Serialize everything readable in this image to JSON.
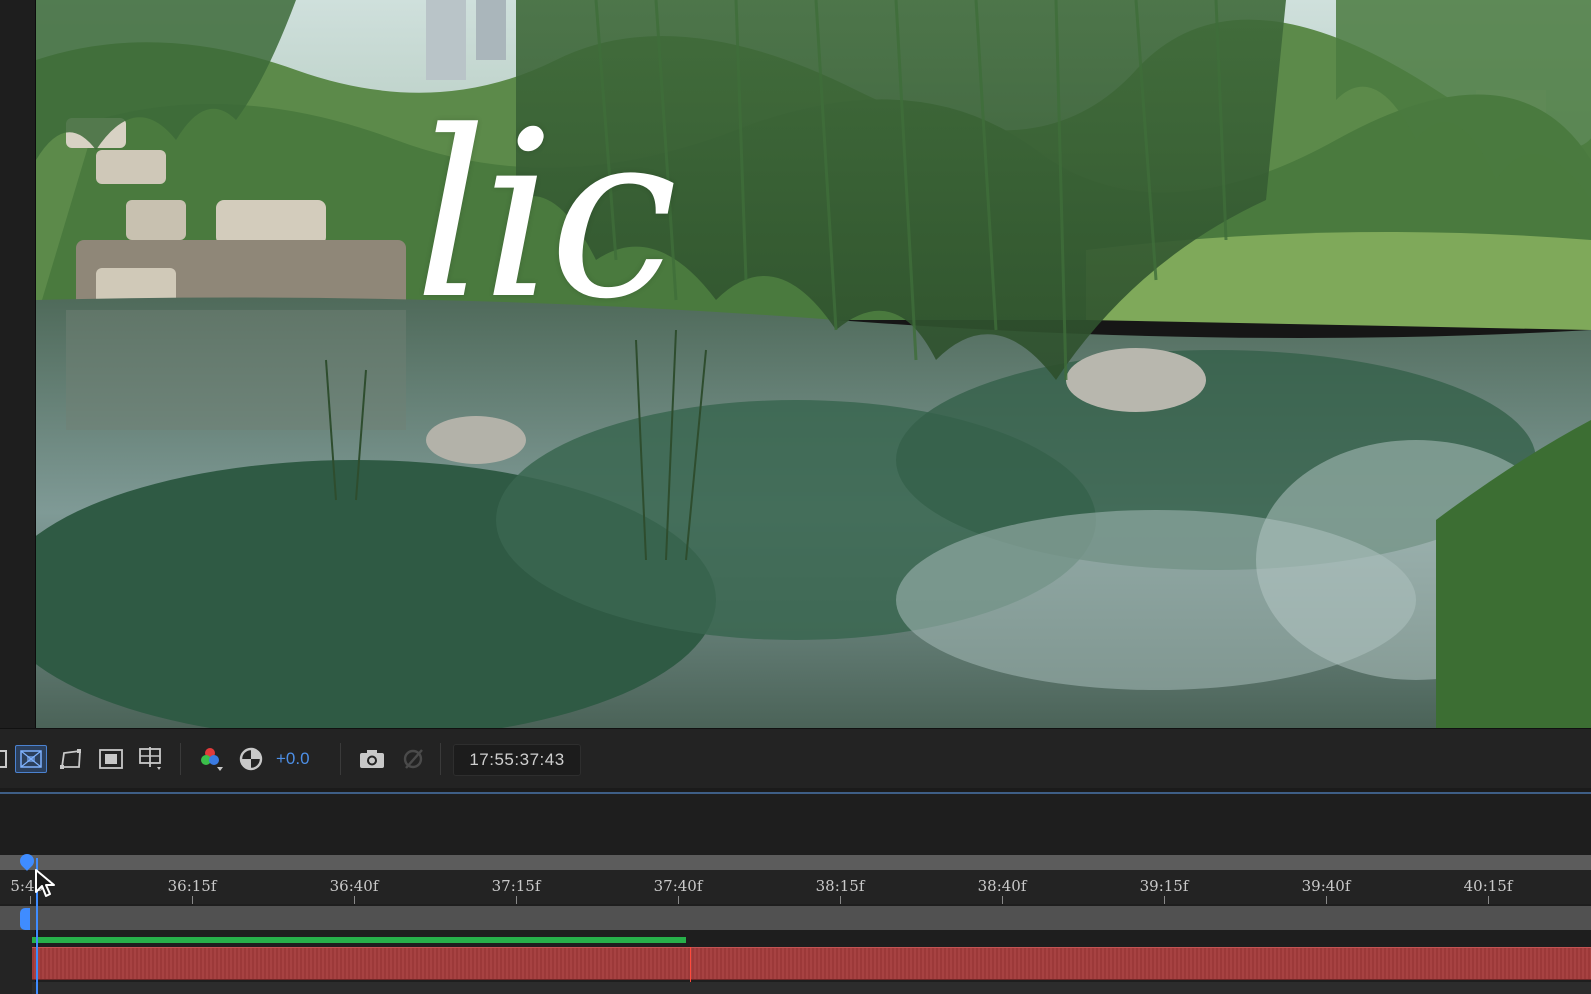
{
  "viewer": {
    "overlay_text": "lic"
  },
  "toolbar": {
    "exposure_value": "+0.0",
    "timecode": "17:55:37:43",
    "icons": [
      "region-of-interest-icon",
      "transparency-grid-icon",
      "mask-path-icon",
      "safe-area-icon",
      "grid-guides-icon",
      "color-channels-icon",
      "exposure-reset-icon",
      "snapshot-camera-icon",
      "show-snapshot-icon"
    ]
  },
  "timeline": {
    "ruler_labels": [
      {
        "label": "5:40f"
      },
      {
        "label": "36:15f"
      },
      {
        "label": "36:40f"
      },
      {
        "label": "37:15f"
      },
      {
        "label": "37:40f"
      },
      {
        "label": "38:15f"
      },
      {
        "label": "38:40f"
      },
      {
        "label": "39:15f"
      },
      {
        "label": "39:40f"
      },
      {
        "label": "40:15f"
      }
    ],
    "colors": {
      "layer_bar": "#a43c3c",
      "render_bar": "#27b04a",
      "playhead": "#3f8cff",
      "accent": "#4d8fe6"
    }
  }
}
